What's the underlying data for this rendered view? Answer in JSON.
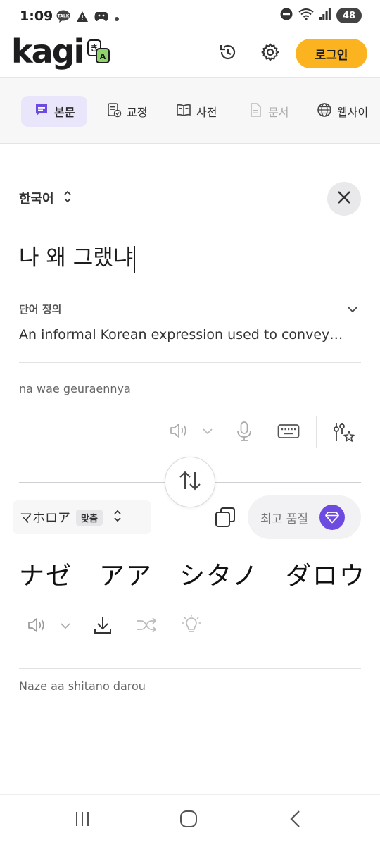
{
  "status_bar": {
    "time": "1:09",
    "battery": "48",
    "left_icons": [
      "talk-icon",
      "warning-icon",
      "game-controller-icon",
      "dot-icon"
    ],
    "right_icons": [
      "do-not-disturb-icon",
      "wifi-icon",
      "signal-icon",
      "battery-icon"
    ]
  },
  "header": {
    "logo_text": "kagi",
    "login_label": "로그인",
    "accent_color": "#fbb41f"
  },
  "tabs": [
    {
      "label": "본문",
      "icon": "text-icon",
      "active": true
    },
    {
      "label": "교정",
      "icon": "proofread-icon",
      "active": false
    },
    {
      "label": "사전",
      "icon": "dictionary-icon",
      "active": false
    },
    {
      "label": "문서",
      "icon": "document-icon",
      "active": false,
      "disabled": true
    },
    {
      "label": "웹사이",
      "icon": "globe-icon",
      "active": false
    }
  ],
  "source": {
    "language": "한국어",
    "text": "나 왜 그랬냐",
    "definition_label": "단어 정의",
    "definition_text": "An informal Korean expression used to convey…",
    "romanization": "na wae geuraennya"
  },
  "target": {
    "language": "マホロア",
    "match_badge": "맞춤",
    "quality_label": "최고 품질",
    "text": "ナゼ　アア　シタノ　ダロウ",
    "romanization": "Naze aa shitano darou"
  },
  "colors": {
    "active_tab_bg": "#e9e6fb",
    "gem_purple": "#6d4be0"
  }
}
